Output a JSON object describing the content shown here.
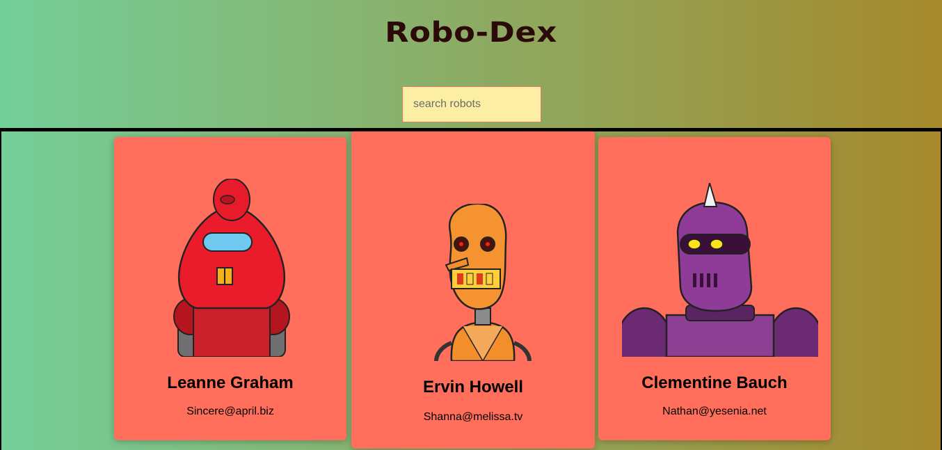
{
  "header": {
    "title": "Robo-Dex"
  },
  "search": {
    "placeholder": "search robots"
  },
  "robots": [
    {
      "name": "Leanne Graham",
      "email": "Sincere@april.biz",
      "avatar_icon": "red-robot-icon"
    },
    {
      "name": "Ervin Howell",
      "email": "Shanna@melissa.tv",
      "avatar_icon": "orange-robot-icon"
    },
    {
      "name": "Clementine Bauch",
      "email": "Nathan@yesenia.net",
      "avatar_icon": "purple-robot-icon"
    }
  ],
  "colors": {
    "card_background": "#ff6f5b",
    "search_background": "#fcefa4",
    "title_color": "#2c0a0a",
    "gradient_left": "#74cf99",
    "gradient_right": "#a6892c"
  }
}
